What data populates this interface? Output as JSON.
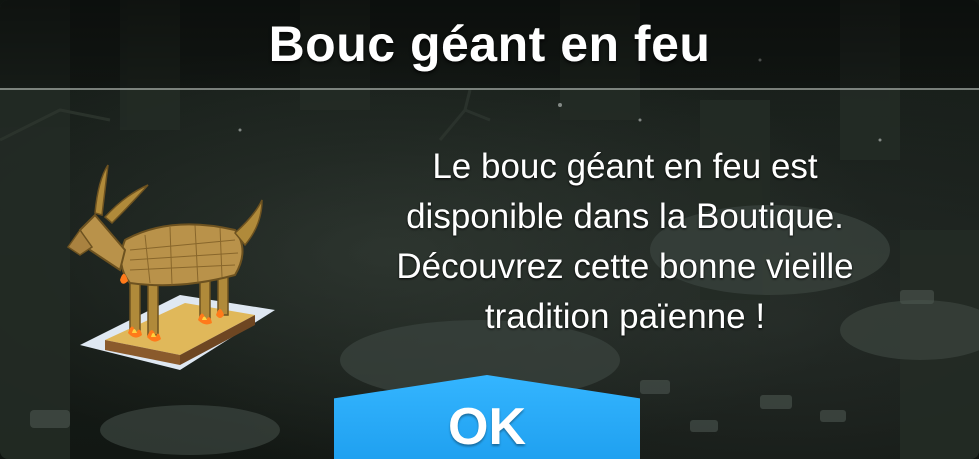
{
  "dialog": {
    "title": "Bouc géant en feu",
    "message": "Le bouc géant en feu est\ndisponible dans la Boutique.\nDécouvrez cette bonne vieille\ntradition païenne !",
    "image_icon": "burning-straw-goat",
    "ok_label": "OK"
  },
  "colors": {
    "button": "#29acf8",
    "text": "#ffffff",
    "background": "#161c18"
  }
}
